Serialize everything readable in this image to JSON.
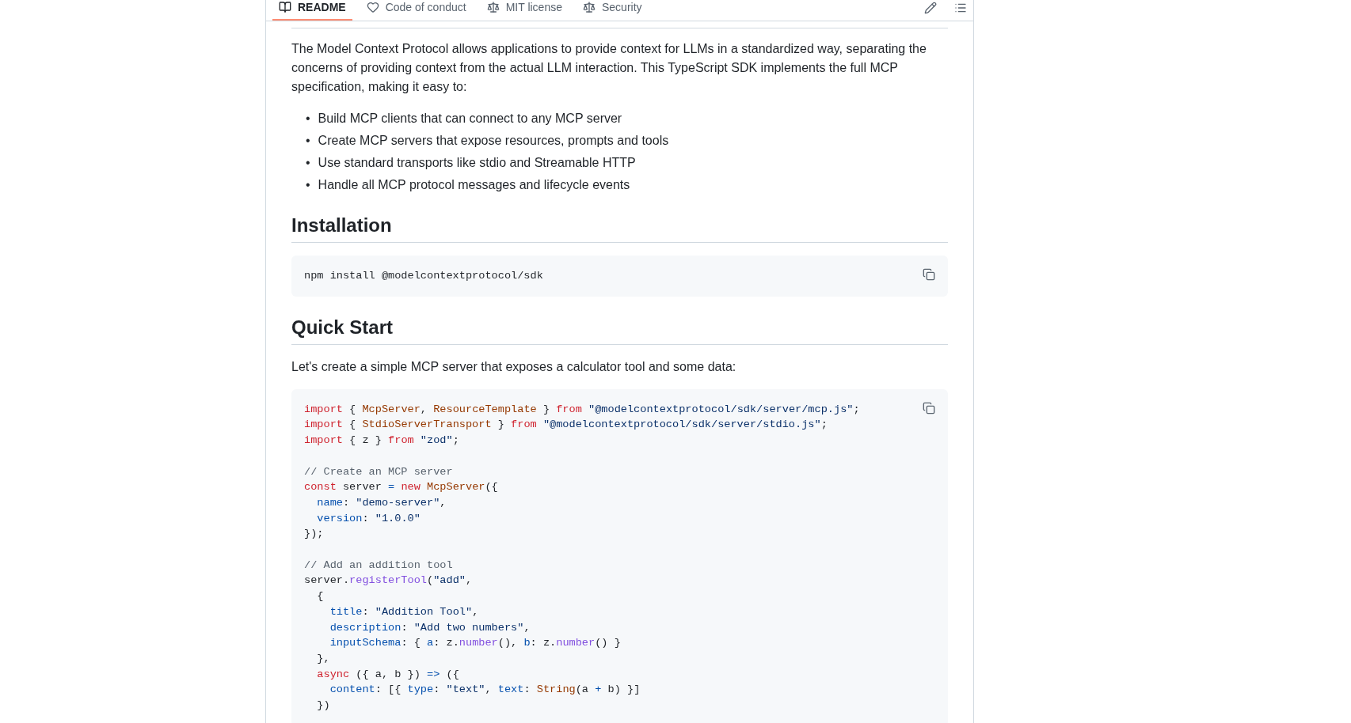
{
  "tabs": [
    {
      "label": "README",
      "selected": true
    },
    {
      "label": "Code of conduct",
      "selected": false
    },
    {
      "label": "MIT license",
      "selected": false
    },
    {
      "label": "Security",
      "selected": false
    }
  ],
  "intro": "The Model Context Protocol allows applications to provide context for LLMs in a standardized way, separating the concerns of providing context from the actual LLM interaction. This TypeScript SDK implements the full MCP specification, making it easy to:",
  "features": [
    {
      "bullet": "•",
      "text": "Build MCP clients that can connect to any MCP server"
    },
    {
      "bullet": "•",
      "text": "Create MCP servers that expose resources, prompts and tools"
    },
    {
      "bullet": "•",
      "text": "Use standard transports like stdio and Streamable HTTP"
    },
    {
      "bullet": "•",
      "text": "Handle all MCP protocol messages and lifecycle events"
    }
  ],
  "installation": {
    "heading": "Installation",
    "command": "npm install @modelcontextprotocol/sdk"
  },
  "quick_start": {
    "heading": "Quick Start",
    "text": "Let's create a simple MCP server that exposes a calculator tool and some data:",
    "code_blocks": [
      [
        [
          {
            "kind": "keyword",
            "text": "import"
          },
          {
            "kind": "plain",
            "text": " { "
          },
          {
            "kind": "entity",
            "text": "McpServer"
          },
          {
            "kind": "plain",
            "text": ", "
          },
          {
            "kind": "entity",
            "text": "ResourceTemplate"
          },
          {
            "kind": "plain",
            "text": " } "
          },
          {
            "kind": "keyword",
            "text": "from"
          },
          {
            "kind": "string",
            "text": " \"@modelcontextprotocol/sdk/server/mcp.js\""
          },
          {
            "kind": "plain",
            "text": ";"
          }
        ],
        [
          {
            "kind": "keyword",
            "text": "import"
          },
          {
            "kind": "plain",
            "text": " { "
          },
          {
            "kind": "entity",
            "text": "StdioServerTransport"
          },
          {
            "kind": "plain",
            "text": " } "
          },
          {
            "kind": "keyword",
            "text": "from"
          },
          {
            "kind": "string",
            "text": " \"@modelcontextprotocol/sdk/server/stdio.js\""
          },
          {
            "kind": "plain",
            "text": ";"
          }
        ],
        [
          {
            "kind": "keyword",
            "text": "import"
          },
          {
            "kind": "plain",
            "text": " { z } "
          },
          {
            "kind": "keyword",
            "text": "from"
          },
          {
            "kind": "string",
            "text": " \"zod\""
          },
          {
            "kind": "plain",
            "text": ";"
          }
        ]
      ],
      [
        [
          {
            "kind": "comment",
            "text": "// Create an MCP server"
          }
        ],
        [
          {
            "kind": "keyword",
            "text": "const"
          },
          {
            "kind": "plain",
            "text": " server "
          },
          {
            "kind": "operator",
            "text": "="
          },
          {
            "kind": "keyword",
            "text": " new"
          },
          {
            "kind": "entity",
            "text": " McpServer"
          },
          {
            "kind": "plain",
            "text": "({"
          }
        ],
        [
          {
            "kind": "property",
            "text": "  name"
          },
          {
            "kind": "plain",
            "text": ": "
          },
          {
            "kind": "string",
            "text": "\"demo-server\""
          },
          {
            "kind": "plain",
            "text": ","
          }
        ],
        [
          {
            "kind": "property",
            "text": "  version"
          },
          {
            "kind": "plain",
            "text": ": "
          },
          {
            "kind": "string",
            "text": "\"1.0.0\""
          }
        ],
        [
          {
            "kind": "plain",
            "text": "});"
          }
        ]
      ],
      [
        [
          {
            "kind": "comment",
            "text": "// Add an addition tool"
          }
        ],
        [
          {
            "kind": "plain",
            "text": "server."
          },
          {
            "kind": "function",
            "text": "registerTool"
          },
          {
            "kind": "plain",
            "text": "("
          },
          {
            "kind": "string",
            "text": "\"add\""
          },
          {
            "kind": "plain",
            "text": ","
          }
        ],
        [
          {
            "kind": "plain",
            "text": "  {"
          }
        ],
        [
          {
            "kind": "property",
            "text": "    title"
          },
          {
            "kind": "plain",
            "text": ": "
          },
          {
            "kind": "string",
            "text": "\"Addition Tool\""
          },
          {
            "kind": "plain",
            "text": ","
          }
        ],
        [
          {
            "kind": "property",
            "text": "    description"
          },
          {
            "kind": "plain",
            "text": ": "
          },
          {
            "kind": "string",
            "text": "\"Add two numbers\""
          },
          {
            "kind": "plain",
            "text": ","
          }
        ],
        [
          {
            "kind": "property",
            "text": "    inputSchema"
          },
          {
            "kind": "plain",
            "text": ": { "
          },
          {
            "kind": "property",
            "text": "a"
          },
          {
            "kind": "plain",
            "text": ": z."
          },
          {
            "kind": "function",
            "text": "number"
          },
          {
            "kind": "plain",
            "text": "(), "
          },
          {
            "kind": "property",
            "text": "b"
          },
          {
            "kind": "plain",
            "text": ": z."
          },
          {
            "kind": "function",
            "text": "number"
          },
          {
            "kind": "plain",
            "text": "() }"
          }
        ],
        [
          {
            "kind": "plain",
            "text": "  },"
          }
        ],
        [
          {
            "kind": "keyword",
            "text": "  async"
          },
          {
            "kind": "plain",
            "text": " ({ a, b }) "
          },
          {
            "kind": "operator",
            "text": "=>"
          },
          {
            "kind": "plain",
            "text": " ({"
          }
        ],
        [
          {
            "kind": "property",
            "text": "    content"
          },
          {
            "kind": "plain",
            "text": ": [{ "
          },
          {
            "kind": "property",
            "text": "type"
          },
          {
            "kind": "plain",
            "text": ": "
          },
          {
            "kind": "string",
            "text": "\"text\""
          },
          {
            "kind": "plain",
            "text": ", "
          },
          {
            "kind": "property",
            "text": "text"
          },
          {
            "kind": "plain",
            "text": ": "
          },
          {
            "kind": "entity",
            "text": "String"
          },
          {
            "kind": "plain",
            "text": "(a "
          },
          {
            "kind": "operator",
            "text": "+"
          },
          {
            "kind": "plain",
            "text": " b) }]"
          }
        ],
        [
          {
            "kind": "plain",
            "text": "  })"
          }
        ]
      ]
    ]
  }
}
